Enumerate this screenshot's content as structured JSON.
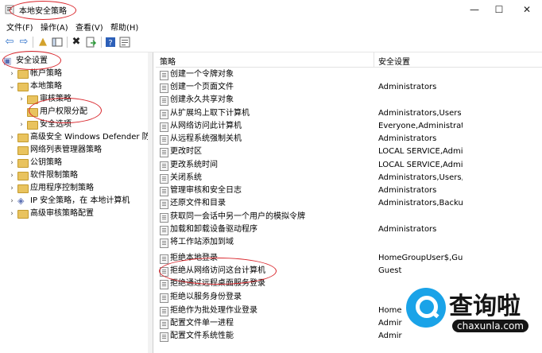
{
  "window": {
    "title": "本地安全策略",
    "minimize": "—",
    "maximize": "☐",
    "close": "✕"
  },
  "menu": [
    "文件(F)",
    "操作(A)",
    "查看(V)",
    "帮助(H)"
  ],
  "tree": {
    "root": "安全设置",
    "items": [
      {
        "label": "帐户策略",
        "exp": "›"
      },
      {
        "label": "本地策略",
        "exp": "⌄"
      },
      {
        "label": "审核策略",
        "exp": "›"
      },
      {
        "label": "用户权限分配",
        "exp": ""
      },
      {
        "label": "安全选项",
        "exp": "›"
      },
      {
        "label": "高级安全 Windows Defender 防火墙",
        "exp": "›"
      },
      {
        "label": "网络列表管理器策略",
        "exp": ""
      },
      {
        "label": "公钥策略",
        "exp": "›"
      },
      {
        "label": "软件限制策略",
        "exp": "›"
      },
      {
        "label": "应用程序控制策略",
        "exp": "›"
      },
      {
        "label": "IP 安全策略，在 本地计算机",
        "exp": "›"
      },
      {
        "label": "高级审核策略配置",
        "exp": "›"
      }
    ]
  },
  "list": {
    "col_policy": "策略",
    "col_setting": "安全设置",
    "rows": [
      {
        "policy": "创建一个令牌对象",
        "setting": ""
      },
      {
        "policy": "创建一个页面文件",
        "setting": "Administrators"
      },
      {
        "policy": "创建永久共享对象",
        "setting": ""
      },
      {
        "policy": "从扩展坞上取下计算机",
        "setting": "Administrators,Users"
      },
      {
        "policy": "从网络访问此计算机",
        "setting": "Everyone,Administrat..."
      },
      {
        "policy": "从远程系统强制关机",
        "setting": "Administrators"
      },
      {
        "policy": "更改时区",
        "setting": "LOCAL SERVICE,Admi..."
      },
      {
        "policy": "更改系统时间",
        "setting": "LOCAL SERVICE,Admi..."
      },
      {
        "policy": "关闭系统",
        "setting": "Administrators,Users,..."
      },
      {
        "policy": "管理审核和安全日志",
        "setting": "Administrators"
      },
      {
        "policy": "还原文件和目录",
        "setting": "Administrators,Backu..."
      },
      {
        "policy": "获取同一会话中另一个用户的模拟令牌",
        "setting": ""
      },
      {
        "policy": "加载和卸载设备驱动程序",
        "setting": "Administrators"
      },
      {
        "policy": "将工作站添加到域",
        "setting": ""
      },
      {
        "policy": "拒绝本地登录",
        "setting": "HomeGroupUser$,Gu..."
      },
      {
        "policy": "拒绝从网络访问这台计算机",
        "setting": "Guest"
      },
      {
        "policy": "拒绝通过远程桌面服务登录",
        "setting": ""
      },
      {
        "policy": "拒绝以服务身份登录",
        "setting": ""
      },
      {
        "policy": "拒绝作为批处理作业登录",
        "setting": "Home"
      },
      {
        "policy": "配置文件单一进程",
        "setting": "Admir"
      },
      {
        "policy": "配置文件系统性能",
        "setting": "Admir"
      }
    ]
  },
  "watermark": {
    "cn": "查询啦",
    "en": "chaxunla.com"
  }
}
